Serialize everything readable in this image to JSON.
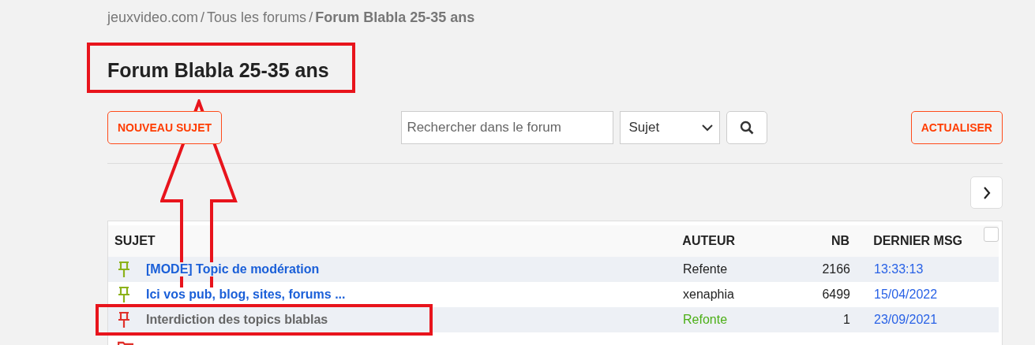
{
  "breadcrumb": [
    {
      "label": "jeuxvideo.com",
      "current": false
    },
    {
      "label": "Tous les forums",
      "current": false
    },
    {
      "label": "Forum Blabla 25-35 ans",
      "current": true
    }
  ],
  "separator": "/",
  "title": "Forum Blabla 25-35 ans",
  "toolbar": {
    "new_button": "NOUVEAU SUJET",
    "search": {
      "placeholder": "Rechercher dans le forum"
    },
    "scope": "Sujet",
    "refresh_button": "ACTUALISER"
  },
  "table": {
    "columns": [
      "SUJET",
      "AUTEUR",
      "NB",
      "DERNIER MSG"
    ],
    "select_all": {
      "checked": false
    },
    "rows": [
      {
        "kind": "pinned",
        "color": "#8cb21a",
        "locked": false,
        "subject": "[MODE] Topic de modération",
        "author": "Refente",
        "admin": false,
        "count": "2166",
        "last": "13:33:13"
      },
      {
        "kind": "pinned",
        "color": "#8cb21a",
        "locked": false,
        "subject": "Ici vos pub, blog, sites, forums ...",
        "author": "xenaphia",
        "admin": false,
        "count": "6499",
        "last": "15/04/2022"
      },
      {
        "kind": "pinned",
        "color": "#e0312b",
        "locked": true,
        "subject": "Interdiction des topics blablas",
        "author": "Refonte",
        "admin": true,
        "count": "1",
        "last": "23/09/2021"
      },
      {
        "kind": "folder",
        "color": "#e0312b"
      }
    ]
  },
  "annotations": [
    {
      "kind": "box"
    },
    {
      "kind": "box"
    },
    {
      "kind": "arrow"
    }
  ]
}
